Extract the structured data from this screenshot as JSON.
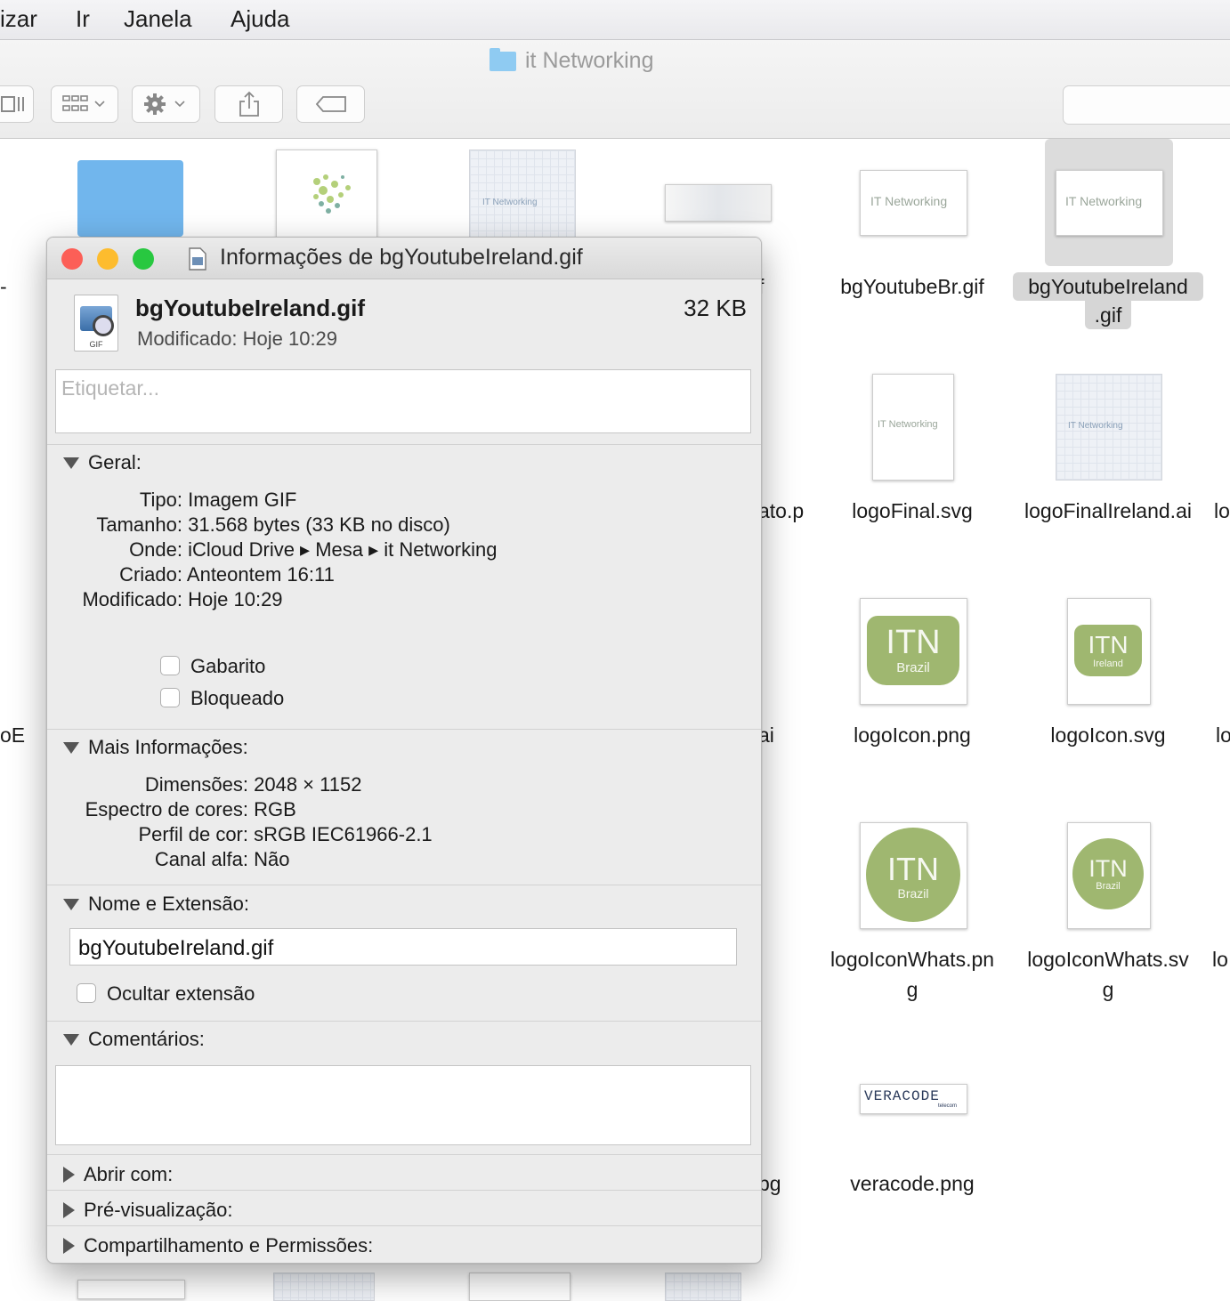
{
  "menubar": {
    "items": [
      "izar",
      "Ir",
      "Janela",
      "Ajuda"
    ]
  },
  "finder": {
    "title": "it Networking",
    "files": [
      {
        "label": "-"
      },
      {
        "label": "f"
      },
      {
        "label": "bgYoutubeBr.gif",
        "thumb_text": "IT Networking"
      },
      {
        "label_line1": "bgYoutubeIreland",
        "label_line2": ".gif",
        "thumb_text": "IT Networking"
      },
      {
        "label": "ato.p"
      },
      {
        "label": "logoFinal.svg",
        "thumb_text": "IT Networking"
      },
      {
        "label": "logoFinalIreland.ai",
        "thumb_text": "IT Networking"
      },
      {
        "label": "lo"
      },
      {
        "label": "oE"
      },
      {
        "label": "ai"
      },
      {
        "label": "logoIcon.png",
        "badge_big": "ITN",
        "badge_small": "Brazil"
      },
      {
        "label": "logoIcon.svg",
        "badge_big": "ITN",
        "badge_small": "Ireland"
      },
      {
        "label": "lo"
      },
      {
        "label_line1": "logoIconWhats.pn",
        "label_line2": "g",
        "badge_big": "ITN",
        "badge_small": "Brazil"
      },
      {
        "label_line1": "logoIconWhats.sv",
        "label_line2": "g",
        "badge_big": "ITN",
        "badge_small": "Brazil"
      },
      {
        "label": "lo"
      },
      {
        "label": "pg"
      },
      {
        "label": "veracode.png",
        "logo_text": "VERACODE",
        "logo_sub": "telecom"
      }
    ]
  },
  "info": {
    "title": "Informações de bgYoutubeIreland.gif",
    "file_icon_label": "GIF",
    "file_name": "bgYoutubeIreland.gif",
    "file_size": "32 KB",
    "modified_short": "Modificado:  Hoje 10:29",
    "tags_placeholder": "Etiquetar...",
    "general": {
      "header": "Geral:",
      "rows": [
        {
          "k": "Tipo:",
          "v": "Imagem GIF"
        },
        {
          "k": "Tamanho:",
          "v": "31.568 bytes (33 KB no disco)"
        },
        {
          "k": "Onde:",
          "v": "iCloud Drive ▸ Mesa ▸ it Networking"
        },
        {
          "k": "Criado:",
          "v": "Anteontem 16:11"
        },
        {
          "k": "Modificado:",
          "v": "Hoje 10:29"
        }
      ],
      "stationery": "Gabarito",
      "locked": "Bloqueado"
    },
    "more": {
      "header": "Mais Informações:",
      "rows": [
        {
          "k": "Dimensões:",
          "v": "2048 × 1152"
        },
        {
          "k": "Espectro de cores:",
          "v": "RGB"
        },
        {
          "k": "Perfil de cor:",
          "v": "sRGB IEC61966-2.1"
        },
        {
          "k": "Canal alfa:",
          "v": "Não"
        }
      ]
    },
    "name_ext": {
      "header": "Nome e Extensão:",
      "value": "bgYoutubeIreland.gif",
      "hide_ext": "Ocultar extensão"
    },
    "comments": {
      "header": "Comentários:"
    },
    "open_with": "Abrir com:",
    "preview": "Pré-visualização:",
    "sharing": "Compartilhamento e Permissões:"
  },
  "colors": {
    "close": "#fc5f57",
    "minimize": "#fdbc2e",
    "zoom": "#28c840",
    "badge": "#9fb770",
    "folder": "#8fcbf2"
  }
}
